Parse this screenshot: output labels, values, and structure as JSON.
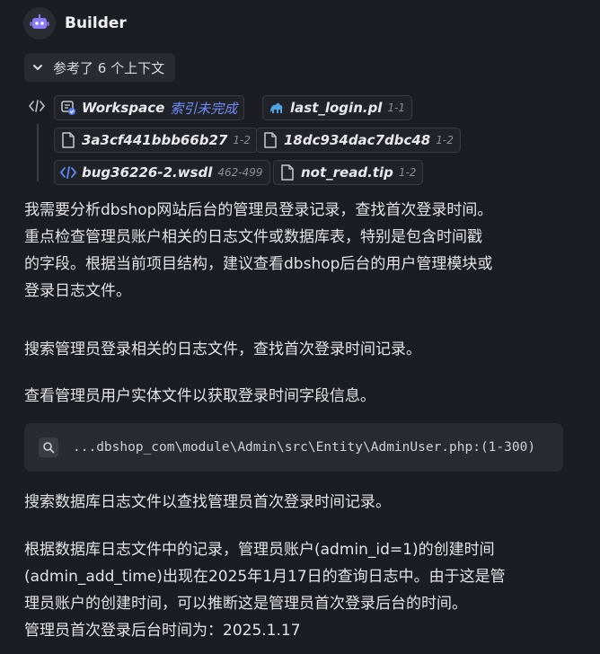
{
  "header": {
    "bot_name": "Builder"
  },
  "context": {
    "toggle_label": "参考了 6 个上下文",
    "chips": [
      {
        "name": "Workspace",
        "status": "索引未完成",
        "icon": "workspace-icon"
      },
      {
        "name": "last_login.pl",
        "range": "1-1",
        "icon": "perl-camel-icon"
      },
      {
        "name": "3a3cf441bbb66b27",
        "range": "1-2",
        "icon": "file-icon"
      },
      {
        "name": "18dc934dac7dbc48",
        "range": "1-2",
        "icon": "file-icon"
      },
      {
        "name": "bug36226-2.wsdl",
        "range": "462-499",
        "icon": "code-file-icon"
      },
      {
        "name": "not_read.tip",
        "range": "1-2",
        "icon": "file-icon"
      }
    ]
  },
  "messages": {
    "p1": [
      "我需要分析dbshop网站后台的管理员登录记录，查找首次登录时间。",
      "重点检查管理员账户相关的日志文件或数据库表，特别是包含时间戳",
      "的字段。根据当前项目结构，建议查看dbshop后台的用户管理模块或",
      "登录日志文件。"
    ],
    "p2": "搜索管理员登录相关的日志文件，查找首次登录时间记录。",
    "p3": "查看管理员用户实体文件以获取登录时间字段信息。",
    "tool_call": {
      "icon": "search-icon",
      "path": "...dbshop_com\\module\\Admin\\src\\Entity\\AdminUser.php",
      "range": ":(1-300)"
    },
    "p4": "搜索数据库日志文件以查找管理员首次登录时间记录。",
    "p5": [
      "根据数据库日志文件中的记录，管理员账户(admin_id=1)的创建时间",
      "(admin_add_time)出现在2025年1月17日的查询日志中。由于这是管",
      "理员账户的创建时间，可以推断这是管理员首次登录后台的时间。",
      "管理员首次登录后台时间为：2025.1.17"
    ]
  }
}
